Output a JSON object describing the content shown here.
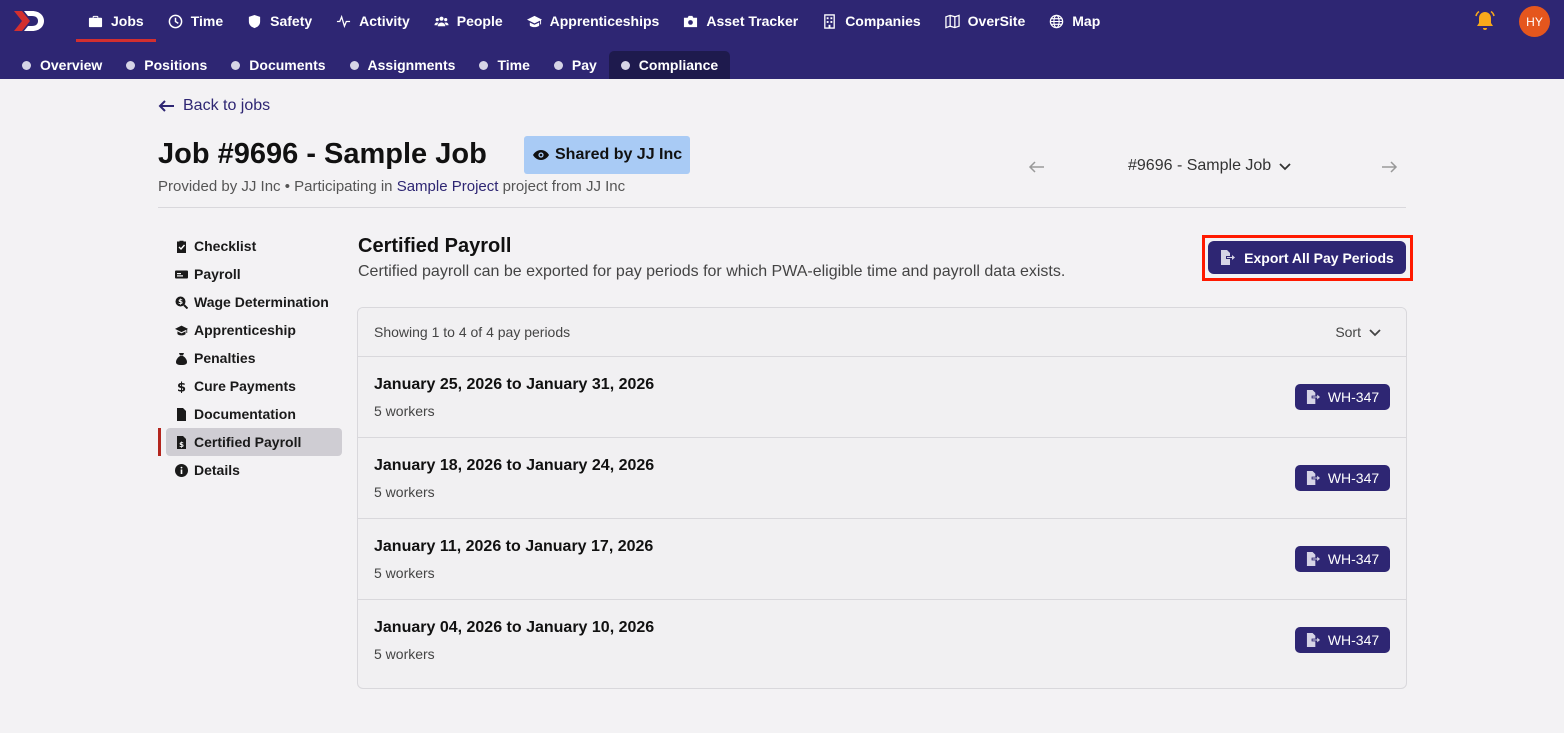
{
  "nav": {
    "items": [
      {
        "label": "Jobs",
        "icon": "briefcase-icon",
        "active": true
      },
      {
        "label": "Time",
        "icon": "clock-icon",
        "active": false
      },
      {
        "label": "Safety",
        "icon": "shield-icon",
        "active": false
      },
      {
        "label": "Activity",
        "icon": "activity-icon",
        "active": false
      },
      {
        "label": "People",
        "icon": "people-icon",
        "active": false
      },
      {
        "label": "Apprenticeships",
        "icon": "graduation-cap-icon",
        "active": false
      },
      {
        "label": "Asset Tracker",
        "icon": "asset-icon",
        "active": false
      },
      {
        "label": "Companies",
        "icon": "building-icon",
        "active": false
      },
      {
        "label": "OverSite",
        "icon": "map-fold-icon",
        "active": false
      },
      {
        "label": "Map",
        "icon": "globe-icon",
        "active": false
      }
    ],
    "avatar_initials": "HY"
  },
  "subnav": {
    "items": [
      {
        "label": "Overview",
        "active": false
      },
      {
        "label": "Positions",
        "active": false
      },
      {
        "label": "Documents",
        "active": false
      },
      {
        "label": "Assignments",
        "active": false
      },
      {
        "label": "Time",
        "active": false
      },
      {
        "label": "Pay",
        "active": false
      },
      {
        "label": "Compliance",
        "active": true
      }
    ]
  },
  "header": {
    "back_label": "Back to jobs",
    "title": "Job #9696 - Sample Job",
    "shared_badge": "Shared by JJ Inc",
    "subtitle_prefix": "Provided by JJ Inc • Participating in ",
    "subtitle_link": "Sample Project",
    "subtitle_suffix": " project from JJ Inc",
    "job_selector": "#9696 - Sample Job"
  },
  "sidebar": {
    "items": [
      {
        "label": "Checklist",
        "icon": "clipboard-check-icon",
        "active": false
      },
      {
        "label": "Payroll",
        "icon": "money-check-icon",
        "active": false
      },
      {
        "label": "Wage Determination",
        "icon": "search-dollar-icon",
        "active": false
      },
      {
        "label": "Apprenticeship",
        "icon": "graduation-cap-icon",
        "active": false
      },
      {
        "label": "Penalties",
        "icon": "money-bag-icon",
        "active": false
      },
      {
        "label": "Cure Payments",
        "icon": "dollar-icon",
        "active": false
      },
      {
        "label": "Documentation",
        "icon": "file-icon",
        "active": false
      },
      {
        "label": "Certified Payroll",
        "icon": "file-invoice-dollar-icon",
        "active": true
      },
      {
        "label": "Details",
        "icon": "info-circle-icon",
        "active": false
      }
    ]
  },
  "main": {
    "title": "Certified Payroll",
    "description": "Certified payroll can be exported for pay periods for which PWA-eligible time and payroll data exists.",
    "export_label": "Export All Pay Periods",
    "showing_text": "Showing 1 to 4 of 4 pay periods",
    "sort_label": "Sort",
    "periods": [
      {
        "range": "January 25, 2026 to January 31, 2026",
        "workers": "5 workers",
        "action": "WH-347"
      },
      {
        "range": "January 18, 2026 to January 24, 2026",
        "workers": "5 workers",
        "action": "WH-347"
      },
      {
        "range": "January 11, 2026 to January 17, 2026",
        "workers": "5 workers",
        "action": "WH-347"
      },
      {
        "range": "January 04, 2026 to January 10, 2026",
        "workers": "5 workers",
        "action": "WH-347"
      }
    ]
  },
  "colors": {
    "brand": "#2e2673",
    "accent_red": "#d32f2f",
    "highlight": "#ff1a00",
    "badge_blue": "#a9cbf5",
    "avatar": "#e5561d"
  }
}
